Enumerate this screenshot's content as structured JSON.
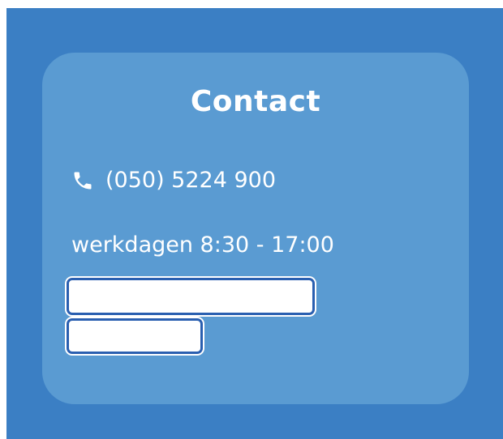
{
  "contact": {
    "title": "Contact",
    "phone": "(050) 5224 900",
    "hours": "werkdagen 8:30 - 17:00",
    "phone_icon": "phone-icon"
  },
  "colors": {
    "background": "#3b7fc4",
    "card": "#5a9bd2",
    "text": "#ffffff",
    "button_border": "#2a5fb0",
    "button_fill": "#ffffff"
  }
}
